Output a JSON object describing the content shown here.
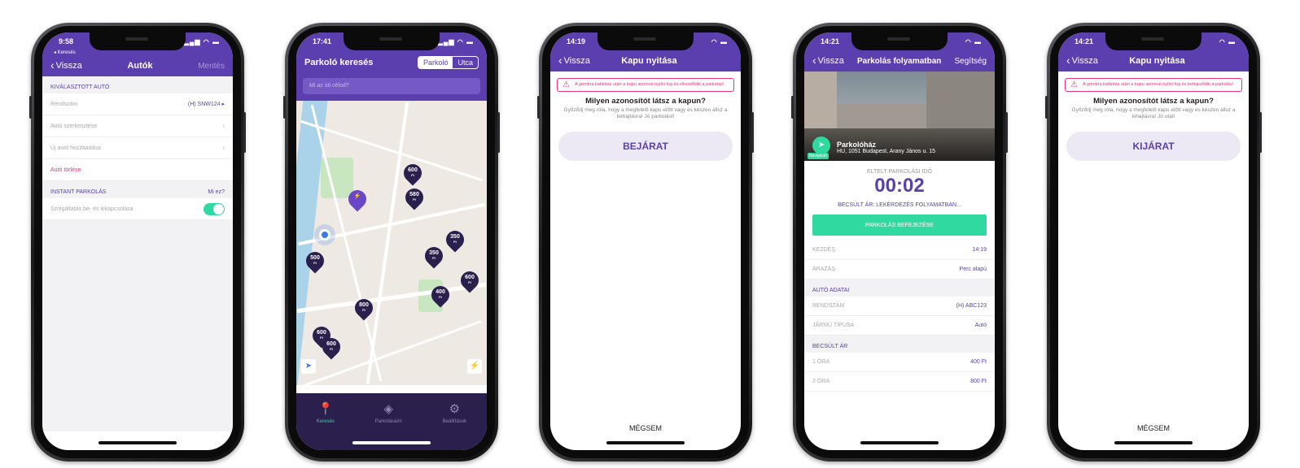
{
  "s1": {
    "time": "9:58",
    "back_small": "◂ Keresés",
    "back": "Vissza",
    "title": "Autók",
    "save": "Mentés",
    "selected_header": "KIVÁLASZTOTT AUTÓ",
    "plate_label": "Rendszám",
    "plate_value": "(H) SNW124 ▸",
    "edit": "Autó szerkesztése",
    "add": "Új autó hozzáadása",
    "delete": "Autó törlése",
    "instant_header": "INSTANT PARKOLÁS",
    "what": "Mi ez?",
    "service": "Szolgáltatás be- és kikapcsolása"
  },
  "s2": {
    "time": "17:41",
    "title": "Parkoló keresés",
    "seg_a": "Parkoló",
    "seg_b": "Utca",
    "search_placeholder": "Mi az úti célod?",
    "pins": [
      "600",
      "580",
      "350",
      "500",
      "350",
      "600",
      "400",
      "800",
      "600",
      "600"
    ],
    "ft": "Ft",
    "tab_search": "Keresés",
    "tab_parkings": "Parkolásaim",
    "tab_settings": "Beállítások"
  },
  "s3": {
    "time": "14:19",
    "back": "Vissza",
    "title": "Kapu nyitása",
    "warning": "A gombra kattintás után a kapu azonnal nyílni fog és elkezdődik a parkolás!",
    "question": "Milyen azonosítót látsz a kapun?",
    "sub": "Győződj meg róla, hogy a megfelelő kapu előtt vagy és készen állsz a behajtásra! Jó parkolást!",
    "button": "BEJÁRAT",
    "cancel": "MÉGSEM"
  },
  "s4": {
    "time": "14:21",
    "back": "Vissza",
    "title": "Parkolás folyamatban",
    "help": "Segítség",
    "navigation": "Navigáció",
    "place_name": "Parkolóház",
    "place_addr": "HU, 1051 Budapest, Arany János u. 15",
    "elapsed_label": "ELTELT PARKOLÁSI IDŐ",
    "timer": "00:02",
    "estimate": "BECSÜLT ÁR: LEKÉRDEZÉS FOLYAMATBAN...",
    "end_button": "PARKOLÁS BEFEJEZÉSE",
    "start_label": "KEZDÉS",
    "start_value": "14:19",
    "pricing_label": "ÁRAZÁS",
    "pricing_value": "Perc alapú",
    "car_header": "AUTÓ ADATAI",
    "plate_label": "RENDSZÁM",
    "plate_value": "(H) ABC123",
    "type_label": "JÁRMŰ TÍPUSA",
    "type_value": "Autó",
    "price_header": "BECSÜLT ÁR",
    "h1_label": "1 ÓRA",
    "h1_value": "400 Ft",
    "h2_label": "2 ÓRA",
    "h2_value": "800 Ft"
  },
  "s5": {
    "time": "14:21",
    "back": "Vissza",
    "title": "Kapu nyitása",
    "warning": "A gombra kattintás után a kapu azonnal nyílni fog és befejeződik a parkolás!",
    "question": "Milyen azonosítót látsz a kapun?",
    "sub": "Győződj meg róla, hogy a megfelelő kapu előtt vagy és készen állsz a kihajtásra! Jó utat!",
    "button": "KIJÁRAT",
    "cancel": "MÉGSEM"
  },
  "colors": {
    "brand": "#5b3fae",
    "accent": "#2fd9a0",
    "danger": "#e6357c",
    "dark": "#2b1f4e"
  }
}
